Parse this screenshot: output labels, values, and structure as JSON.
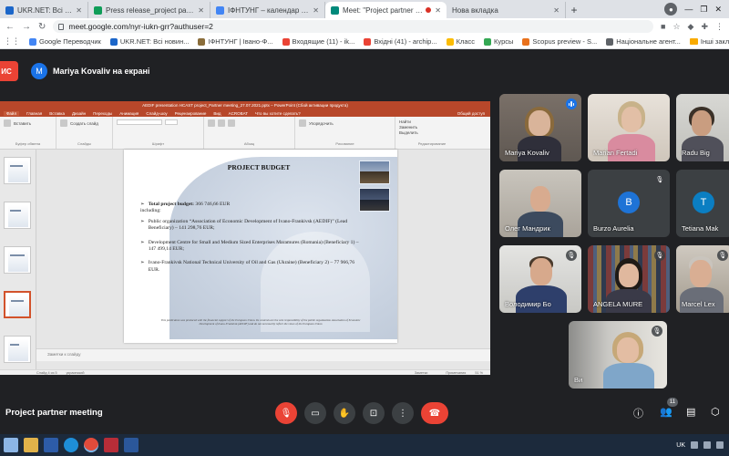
{
  "browser": {
    "tabs": [
      {
        "label": "UKR.NET: Всі новини України, о",
        "favicon_color": "#1b66c9",
        "active": false
      },
      {
        "label": "Press release_project partner m",
        "favicon_color": "#0f9d58",
        "active": false
      },
      {
        "label": "ІФНТУНГ – календар - вівторок,",
        "favicon_color": "#4285f4",
        "active": false
      },
      {
        "label": "Meet: \"Project partner meeti",
        "favicon_color": "#00897b",
        "active": true,
        "recording": true
      },
      {
        "label": "Нова вкладка",
        "favicon_color": "",
        "active": false
      }
    ],
    "new_tab_symbol": "+",
    "url": "meet.google.com/nyr-iukn-grr?authuser=2",
    "bookmarks": [
      {
        "label": "Google Переводчик",
        "color": "#4285f4"
      },
      {
        "label": "UKR.NET: Всі новин...",
        "color": "#1b66c9"
      },
      {
        "label": "ІФНТУНГ | Івано-Ф...",
        "color": "#8a6d3b"
      },
      {
        "label": "Входящие (11) - ik...",
        "color": "#ea4335"
      },
      {
        "label": "Вхідні (41) - archip...",
        "color": "#ea4335"
      },
      {
        "label": "Класс",
        "color": "#fbbc04"
      },
      {
        "label": "Курсы",
        "color": "#34a853"
      },
      {
        "label": "Scopus preview - S...",
        "color": "#e9711c"
      },
      {
        "label": "Національне агент...",
        "color": "#5f6368"
      }
    ],
    "other_bookmarks": "Інші закладки",
    "apps_label": ""
  },
  "meet": {
    "stop_label": "ИС",
    "presenter_initial": "M",
    "presenter_text": "Mariya Kovaliv на екрані",
    "meeting_name": "Project partner meeting",
    "people_count": "11",
    "participants": [
      {
        "name": "Mariya Kovaliv",
        "speaking": true
      },
      {
        "name": "Marian Fertadi",
        "muted": false
      },
      {
        "name": "Radu Big",
        "muted": false
      },
      {
        "name": "Олег Мандрик",
        "muted": false
      },
      {
        "name": "Burzo Aurelia",
        "muted": true,
        "initial": "B"
      },
      {
        "name": "Tetiana Mak",
        "muted": false,
        "initial": "T"
      },
      {
        "name": "Володимир Бо",
        "muted": true
      },
      {
        "name": "ANGELA MURE",
        "muted": true
      },
      {
        "name": "Marcel Lex",
        "muted": true
      },
      {
        "name": "Ви",
        "muted": true
      }
    ]
  },
  "powerpoint": {
    "window_title": "AEDIF presentation HCAST project_Partner meeting_27.07.2021.pptx – PowerPoint (Сбой активации продукта)",
    "tabs": [
      "Файл",
      "Главная",
      "Вставка",
      "Дизайн",
      "Переходы",
      "Анимация",
      "Слайд-шоу",
      "Рецензирование",
      "Вид",
      "ACROBAT",
      "Что вы хотите сделать?"
    ],
    "ribbon_groups": [
      "Буфер обмена",
      "Слайды",
      "Шрифт",
      "Абзац",
      "Рисование",
      "Редактирование"
    ],
    "ribbon_buttons": [
      "Вставить",
      "Создать слайд",
      "Упорядочить",
      "Найти",
      "Заменить",
      "Выделить"
    ],
    "share_label": "Общий доступ",
    "notes_placeholder": "Заметки к слайду",
    "status": {
      "slide": "Слайд 4 из 5",
      "lang": "украинский",
      "notes": "Заметки",
      "comments": "Примечания",
      "zoom": "51 %"
    },
    "slide": {
      "title": "PROJECT BUDGET",
      "total_label": "Total project budget:",
      "total_value": " 366 746,66 EUR",
      "including": "including:",
      "items": [
        "Public organization “Association of Economic Development of Ivano-Frankivsk (AEDIF)” (Lead Beneficiary) – 141 298,76 EUR;",
        "Development Centre for Small and Medium Sized Enterprises Maramures (Romania) (Beneficiary 1) – 147 499,14 EUR;",
        "Ivano-Frankivsk National Technical University of Oil and Gas (Ukraine) (Beneficiary 2) – 77 966,76 EUR."
      ],
      "bullet_symbol": "➢",
      "footer": "This publication was produced with the financial support of the European Union. Its contents are the sole responsibility of the public organization Association of Economic Development of Ivano-Frankivsk (AEDIF) and do not necessarily reflect the views of the European Union"
    }
  },
  "taskbar": {
    "lang": "UK"
  }
}
